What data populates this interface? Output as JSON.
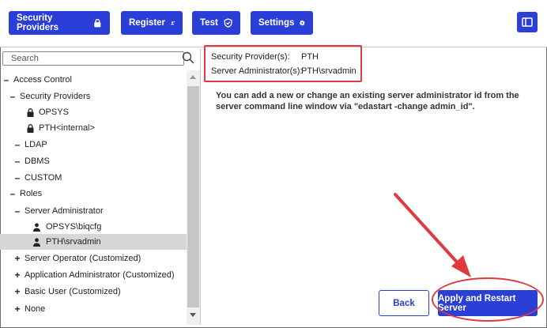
{
  "toolbar": {
    "security_providers_label": "Security Providers",
    "register_label": "Register",
    "test_label": "Test",
    "settings_label": "Settings",
    "accent_color": "#2b3fd6"
  },
  "search": {
    "placeholder": "Search"
  },
  "tree": {
    "access_control": "Access Control",
    "security_providers": "Security Providers",
    "opsys": "OPSYS",
    "pth_internal": "PTH<internal>",
    "ldap": "LDAP",
    "dbms": "DBMS",
    "custom": "CUSTOM",
    "roles": "Roles",
    "server_administrator": "Server Administrator",
    "opsys_biqcfg": "OPSYS\\biqcfg",
    "pth_srvadmin": "PTH\\srvadmin",
    "server_operator": "Server Operator (Customized)",
    "application_administrator": "Application Administrator (Customized)",
    "basic_user": "Basic User (Customized)",
    "none": "None"
  },
  "details": {
    "security_providers_label": "Security Provider(s):",
    "security_providers_value": "PTH",
    "server_admin_label": "Server Administrator(s):",
    "server_admin_value": "PTH\\srvadmin",
    "message": "You can add a new or change an existing server administrator id from the server command line window via \"edastart -change admin_id\"."
  },
  "footer": {
    "back_label": "Back",
    "apply_label": "Apply and Restart Server"
  },
  "highlight_color": "#e0393e"
}
